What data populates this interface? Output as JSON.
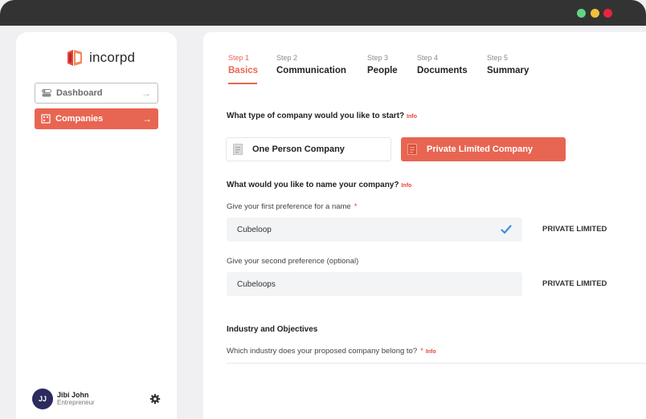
{
  "window": {
    "controls": [
      "green",
      "yellow",
      "red"
    ]
  },
  "sidebar": {
    "logo_text": "incorpd",
    "nav": [
      {
        "label": "Dashboard",
        "icon": "toggle-icon",
        "arrow": "→",
        "active": false
      },
      {
        "label": "Companies",
        "icon": "building-icon",
        "arrow": "→",
        "active": true
      }
    ],
    "user": {
      "initials": "JJ",
      "name": "Jibi John",
      "role": "Entrepreneur"
    }
  },
  "steps": [
    {
      "num": "Step 1",
      "name": "Basics",
      "active": true
    },
    {
      "num": "Step 2",
      "name": "Communication",
      "active": false
    },
    {
      "num": "Step 3",
      "name": "People",
      "active": false
    },
    {
      "num": "Step 4",
      "name": "Documents",
      "active": false
    },
    {
      "num": "Step 5",
      "name": "Summary",
      "active": false
    }
  ],
  "company_type": {
    "question": "What type of company would you like to start?",
    "info": "Info",
    "options": [
      {
        "label": "One Person Company",
        "selected": false
      },
      {
        "label": "Private Limited Company",
        "selected": true
      }
    ]
  },
  "naming": {
    "question": "What would you like to name your company?",
    "info": "Info",
    "first_label": "Give your first preference for a name",
    "required_mark": "*",
    "first_value": "Cubeloop",
    "first_suffix": "PRIVATE LIMITED",
    "second_label": "Give your second preference (optional)",
    "second_value": "Cubeloops",
    "second_suffix": "PRIVATE LIMITED"
  },
  "industry": {
    "heading": "Industry and Objectives",
    "question": "Which industry does your proposed company belong to?",
    "required_mark": "*",
    "info": "Info"
  },
  "colors": {
    "accent": "#e86552",
    "check": "#3b8fe0",
    "avatar": "#2b2b5e"
  }
}
